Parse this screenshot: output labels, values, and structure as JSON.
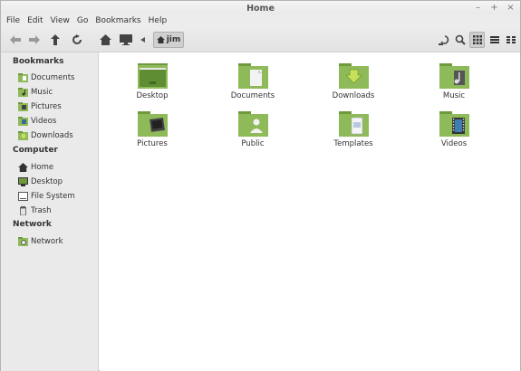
{
  "window": {
    "title": "Home",
    "controls": [
      "–",
      "+",
      "×"
    ]
  },
  "menubar": [
    "File",
    "Edit",
    "View",
    "Go",
    "Bookmarks",
    "Help"
  ],
  "toolbar": {
    "path_label": "jim"
  },
  "sidebar": {
    "bookmarks_title": "Bookmarks",
    "bookmarks": [
      "Documents",
      "Music",
      "Pictures",
      "Videos",
      "Downloads"
    ],
    "computer_title": "Computer",
    "computer": [
      "Home",
      "Desktop",
      "File System",
      "Trash"
    ],
    "network_title": "Network",
    "network": [
      "Network"
    ]
  },
  "folders": [
    "Desktop",
    "Documents",
    "Downloads",
    "Music",
    "Pictures",
    "Public",
    "Templates",
    "Videos"
  ],
  "colors": {
    "folder": "#8fba5a",
    "folder_dark": "#6e9a3d",
    "sidebar": "#eaeaea"
  }
}
